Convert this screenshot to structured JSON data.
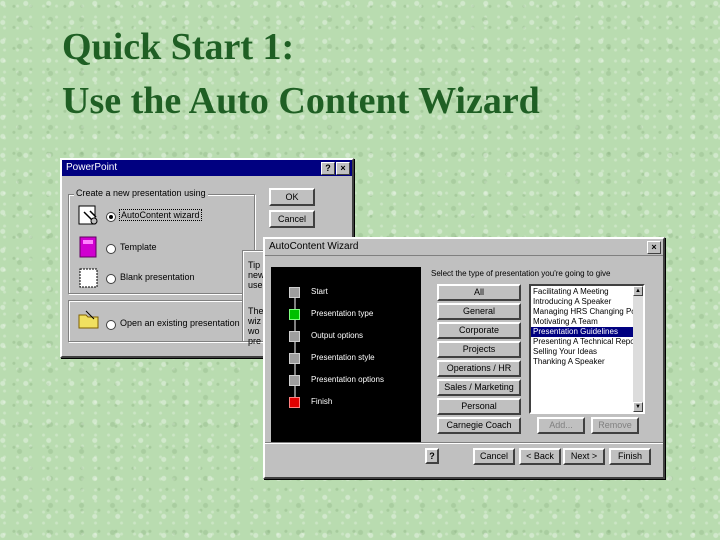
{
  "slide": {
    "title_line1": "Quick Start 1:",
    "title_line2": "Use the Auto Content Wizard"
  },
  "startup_dialog": {
    "title": "PowerPoint",
    "help_btn": "?",
    "close_btn": "×",
    "group_label": "Create a new presentation using",
    "options": {
      "autocontent": "AutoContent wizard",
      "template": "Template",
      "blank": "Blank presentation",
      "open": "Open an existing presentation"
    },
    "ok": "OK",
    "cancel": "Cancel",
    "tip_fragments": [
      "Tip",
      "new",
      "use",
      "The",
      "wiz",
      "wo",
      "pre"
    ]
  },
  "wizard": {
    "title": "AutoContent Wizard",
    "close_btn": "×",
    "steps": [
      "Start",
      "Presentation type",
      "Output options",
      "Presentation style",
      "Presentation options",
      "Finish"
    ],
    "prompt": "Select the type of presentation you're going to give",
    "categories": [
      "All",
      "General",
      "Corporate",
      "Projects",
      "Operations / HR",
      "Sales / Marketing",
      "Personal",
      "Carnegie Coach"
    ],
    "list_items": [
      "Facilitating A Meeting",
      "Introducing A Speaker",
      "Managing HRS Changing Pol",
      "Motivating A Team",
      "Presentation Guidelines",
      "Presenting A Technical Repo",
      "Selling Your Ideas",
      "Thanking A Speaker"
    ],
    "selected_index": 4,
    "add_btn": "Add...",
    "remove_btn": "Remove",
    "help_btn": "?",
    "cancel_btn": "Cancel",
    "back_btn": "< Back",
    "next_btn": "Next >",
    "finish_btn": "Finish",
    "step_colors": {
      "start": "#9e9e9e",
      "current": "#00c000",
      "pending": "#9e9e9e",
      "finish": "#e00000"
    }
  }
}
